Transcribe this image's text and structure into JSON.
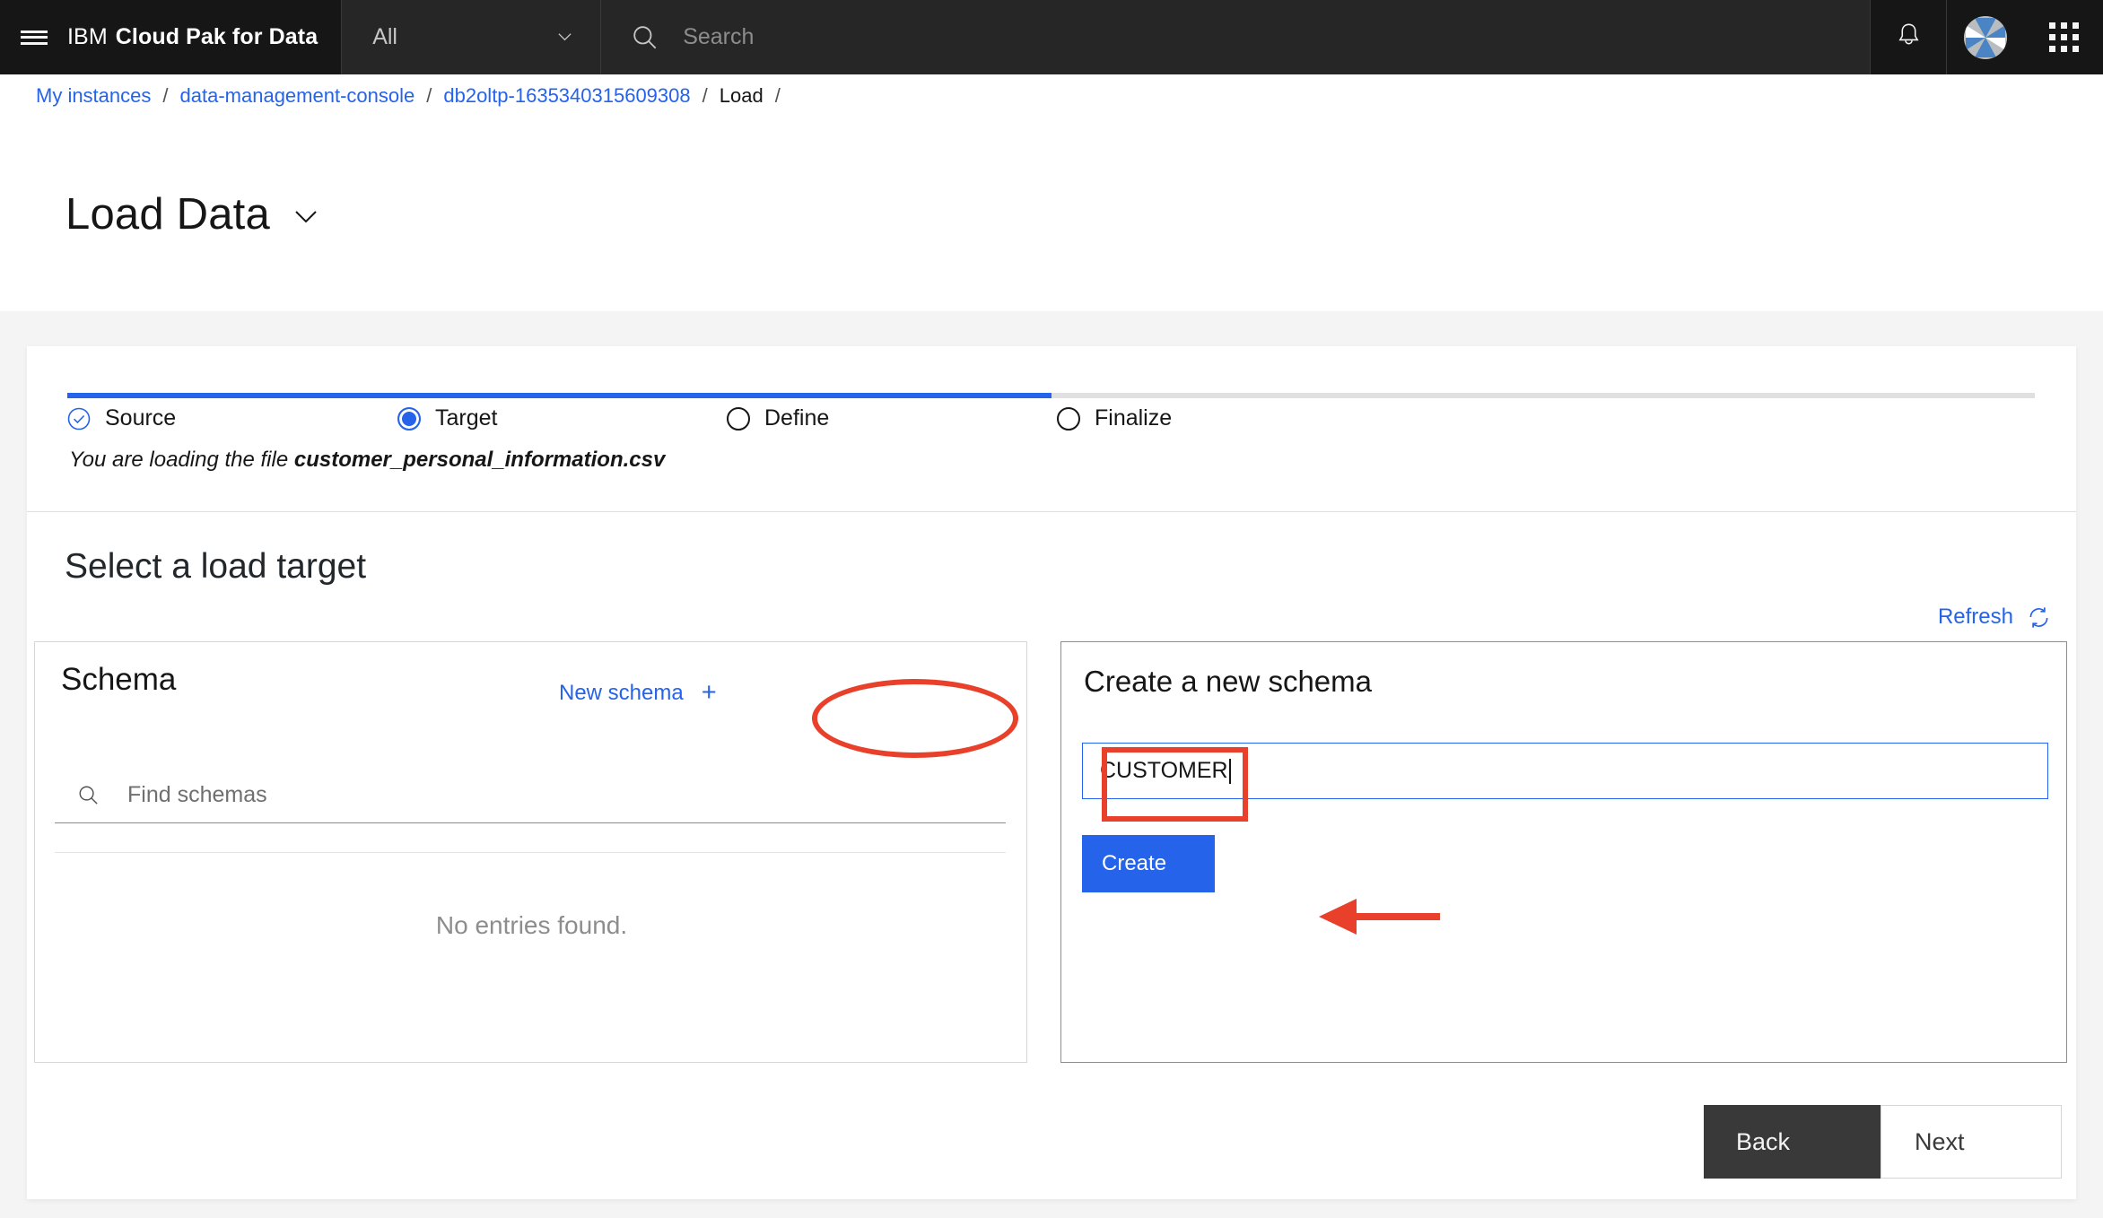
{
  "header": {
    "menu_icon": "hamburger-icon",
    "brand_prefix": "IBM",
    "brand_name": "Cloud Pak for Data",
    "scope_value": "All",
    "scope_chevron": "chevron-down-icon",
    "search_placeholder": "Search",
    "search_value": "",
    "search_icon": "search-icon",
    "notifications_icon": "bell-icon",
    "avatar": "user-avatar",
    "app_switcher_icon": "app-grid-icon"
  },
  "breadcrumb": {
    "items": [
      {
        "label": "My instances",
        "link": true
      },
      {
        "label": "data-management-console",
        "link": true
      },
      {
        "label": "db2oltp-1635340315609308",
        "link": true
      },
      {
        "label": "Load",
        "link": false
      }
    ],
    "separator": "/",
    "trailing_separator": "/"
  },
  "page": {
    "title": "Load Data",
    "title_chevron": "chevron-down-icon"
  },
  "stepper": {
    "steps": [
      {
        "label": "Source",
        "state": "complete"
      },
      {
        "label": "Target",
        "state": "active"
      },
      {
        "label": "Define",
        "state": "pending"
      },
      {
        "label": "Finalize",
        "state": "pending"
      }
    ],
    "progress_percent": 50,
    "note_prefix": "You are loading the file ",
    "note_file": "customer_personal_information.csv"
  },
  "main": {
    "section_title": "Select a load target",
    "refresh_label": "Refresh",
    "refresh_icon": "refresh-icon"
  },
  "schema_panel": {
    "title": "Schema",
    "new_schema_label": "New schema",
    "new_schema_plus": "+",
    "search_placeholder": "Find schemas",
    "search_value": "",
    "search_icon": "search-icon",
    "empty_message": "No entries found."
  },
  "create_panel": {
    "title": "Create a new schema",
    "name_value": "CUSTOMER",
    "name_placeholder": "",
    "create_label": "Create"
  },
  "footer": {
    "back_label": "Back",
    "next_label": "Next"
  },
  "annotations": {
    "color": "#e8402a",
    "ellipse_target": "New schema +",
    "box_target": "schema name input",
    "arrow_target": "Create button"
  },
  "colors": {
    "header_bg": "#161616",
    "accent_blue": "#2563eb",
    "link_blue": "#2563eb",
    "page_bg": "#f4f4f4",
    "annotation_red": "#e8402a",
    "back_button_bg": "#393939"
  }
}
